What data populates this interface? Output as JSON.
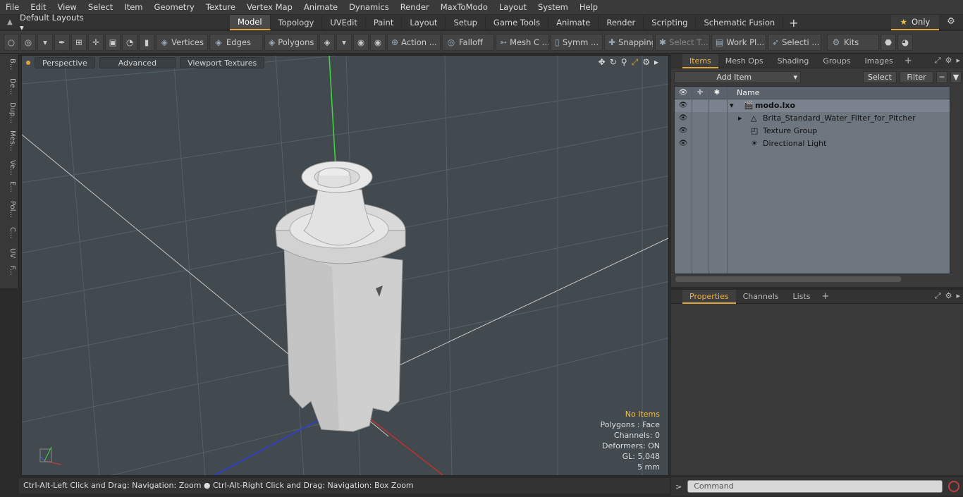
{
  "menu": [
    "File",
    "Edit",
    "View",
    "Select",
    "Item",
    "Geometry",
    "Texture",
    "Vertex Map",
    "Animate",
    "Dynamics",
    "Render",
    "MaxToModo",
    "Layout",
    "System",
    "Help"
  ],
  "layout": {
    "selector": "Default Layouts ▾"
  },
  "tabs": [
    "Model",
    "Topology",
    "UVEdit",
    "Paint",
    "Layout",
    "Setup",
    "Game Tools",
    "Animate",
    "Render",
    "Scripting",
    "Schematic Fusion"
  ],
  "active_tab": "Model",
  "only_label": "Only",
  "toolbar": {
    "vertices": "Vertices",
    "edges": "Edges",
    "polygons": "Polygons",
    "action": "Action ...",
    "falloff": "Falloff",
    "meshc": "Mesh C ...",
    "symm": "Symm ...",
    "snapping": "Snapping",
    "selectt": "Select T...",
    "workpl": "Work Pl...",
    "selecti": "Selecti ...",
    "kits": "Kits"
  },
  "left_tabs": [
    "B...",
    "De...",
    "Dup...",
    "Mes...",
    "Ve...",
    "E...",
    "Pol...",
    "C...",
    "UV",
    "F..."
  ],
  "viewport": {
    "perspective": "Perspective",
    "advanced": "Advanced",
    "viewport_textures": "Viewport Textures",
    "info": {
      "no_items": "No Items",
      "polygons": "Polygons : Face",
      "channels": "Channels: 0",
      "deformers": "Deformers: ON",
      "gl": "GL: 5,048",
      "scale": "5 mm"
    }
  },
  "status": "Ctrl-Alt-Left Click and Drag: Navigation: Zoom ● Ctrl-Alt-Right Click and Drag: Navigation: Box Zoom",
  "items_panel": {
    "tabs": [
      "Items",
      "Mesh Ops",
      "Shading",
      "Groups",
      "Images"
    ],
    "active_tab": "Items",
    "add_item": "Add Item",
    "select": "Select",
    "filter": "Filter",
    "column_name": "Name",
    "tree": [
      {
        "name": "modo.lxo",
        "level": 0,
        "expanded": true
      },
      {
        "name": "Brita_Standard_Water_Filter_for_Pitcher",
        "level": 1
      },
      {
        "name": "Texture Group",
        "level": 1
      },
      {
        "name": "Directional Light",
        "level": 1
      }
    ]
  },
  "properties_panel": {
    "tabs": [
      "Properties",
      "Channels",
      "Lists"
    ],
    "active_tab": "Properties"
  },
  "command": {
    "placeholder": "Command"
  },
  "colors": {
    "accent": "#e0a53c",
    "viewport_bg": "#424a4f",
    "tree_bg": "#6e7680"
  }
}
